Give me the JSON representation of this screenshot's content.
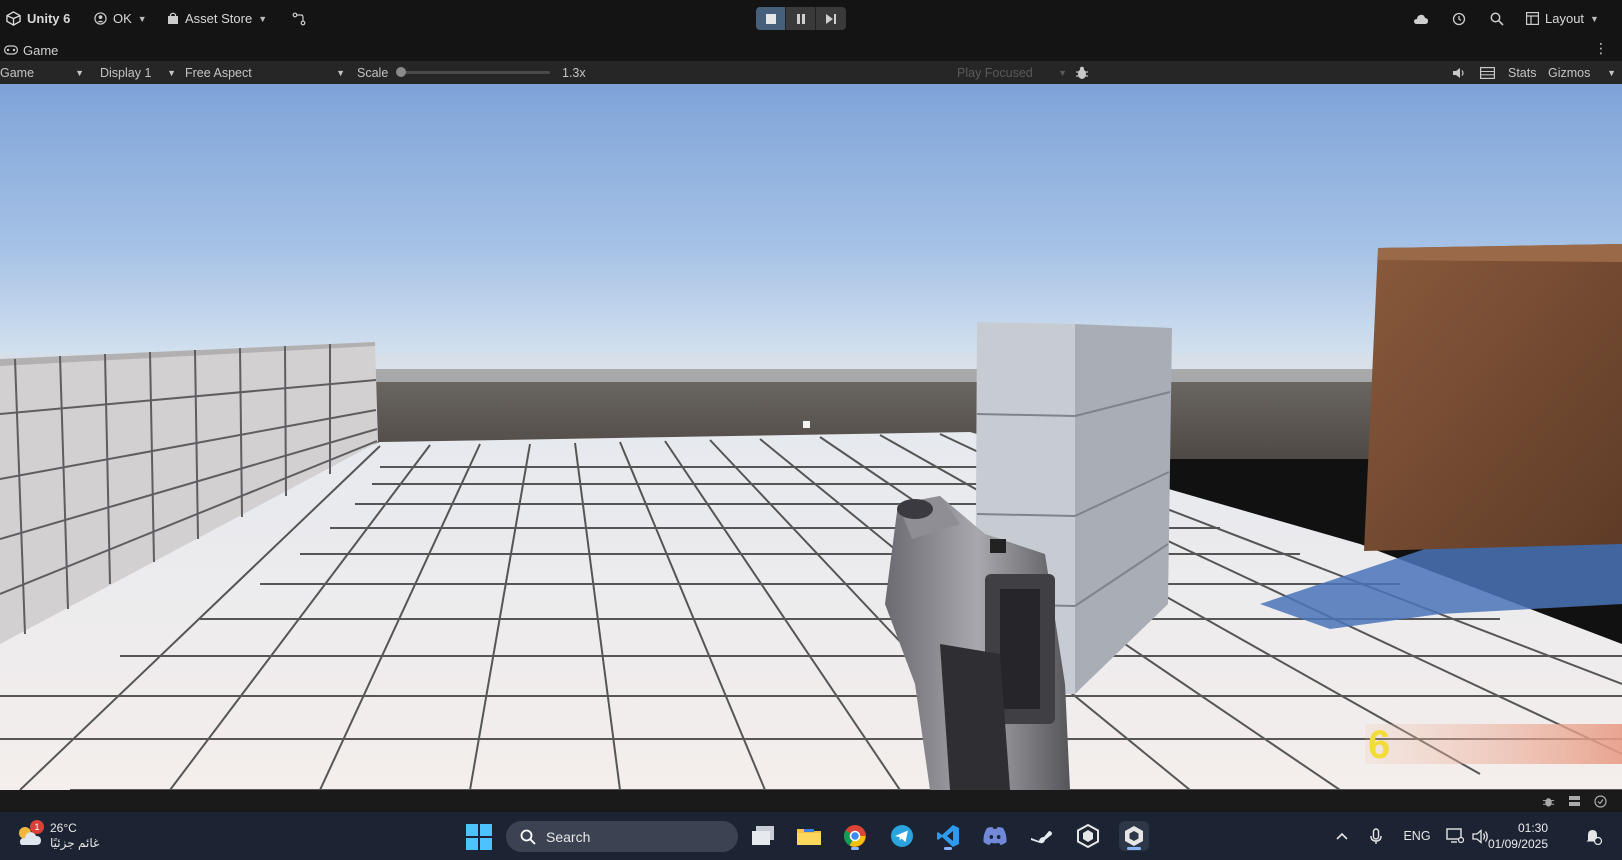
{
  "topbar": {
    "app_name": "Unity 6",
    "account_label": "OK",
    "asset_store_label": "Asset Store",
    "layout_label": "Layout"
  },
  "game_window": {
    "tab_label": "Game",
    "view_dropdown": "Game",
    "display_dropdown": "Display 1",
    "aspect_dropdown": "Free Aspect",
    "scale_label": "Scale",
    "scale_value": "1.3x",
    "scale_fraction": 0.0,
    "play_focused_label": "Play Focused",
    "stats_label": "Stats",
    "gizmos_label": "Gizmos"
  },
  "hud": {
    "ammo_count": "6"
  },
  "taskbar": {
    "weather_temp": "26°C",
    "weather_desc": "غائم جزئيًا",
    "weather_badge": "1",
    "search_label": "Search",
    "language": "ENG",
    "time": "01:30",
    "date": "01/09/2025"
  },
  "colors": {
    "play_active": "#46607c",
    "unity_bar": "#141414",
    "taskbar": "#1c2433",
    "ammo_yellow": "#f2dc3a"
  }
}
